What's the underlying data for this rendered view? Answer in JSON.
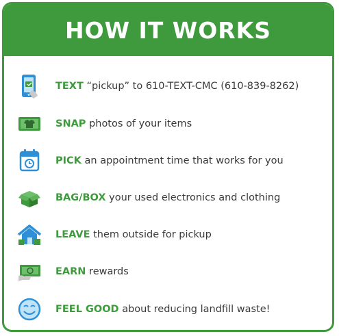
{
  "header": {
    "title": "HOW IT WORKS"
  },
  "steps": [
    {
      "keyword": "TEXT",
      "text": " “pickup” to 610-TEXT-CMC (610-839-8262)",
      "icon": "phone-icon"
    },
    {
      "keyword": "SNAP",
      "text": " photos of your items",
      "icon": "camera-icon"
    },
    {
      "keyword": "PICK",
      "text": " an appointment time that works for you",
      "icon": "calendar-icon"
    },
    {
      "keyword": "BAG/BOX",
      "text": " your used electronics and clothing",
      "icon": "box-icon"
    },
    {
      "keyword": "LEAVE",
      "text": " them outside for pickup",
      "icon": "house-icon"
    },
    {
      "keyword": "EARN",
      "text": " rewards",
      "icon": "money-icon"
    },
    {
      "keyword": "FEEL GOOD",
      "text": " about reducing landfill waste!",
      "icon": "smiley-icon"
    }
  ],
  "colors": {
    "brand_green": "#3f9a3d",
    "icon_blue": "#2e8fd6",
    "icon_green": "#3f9a3d"
  }
}
